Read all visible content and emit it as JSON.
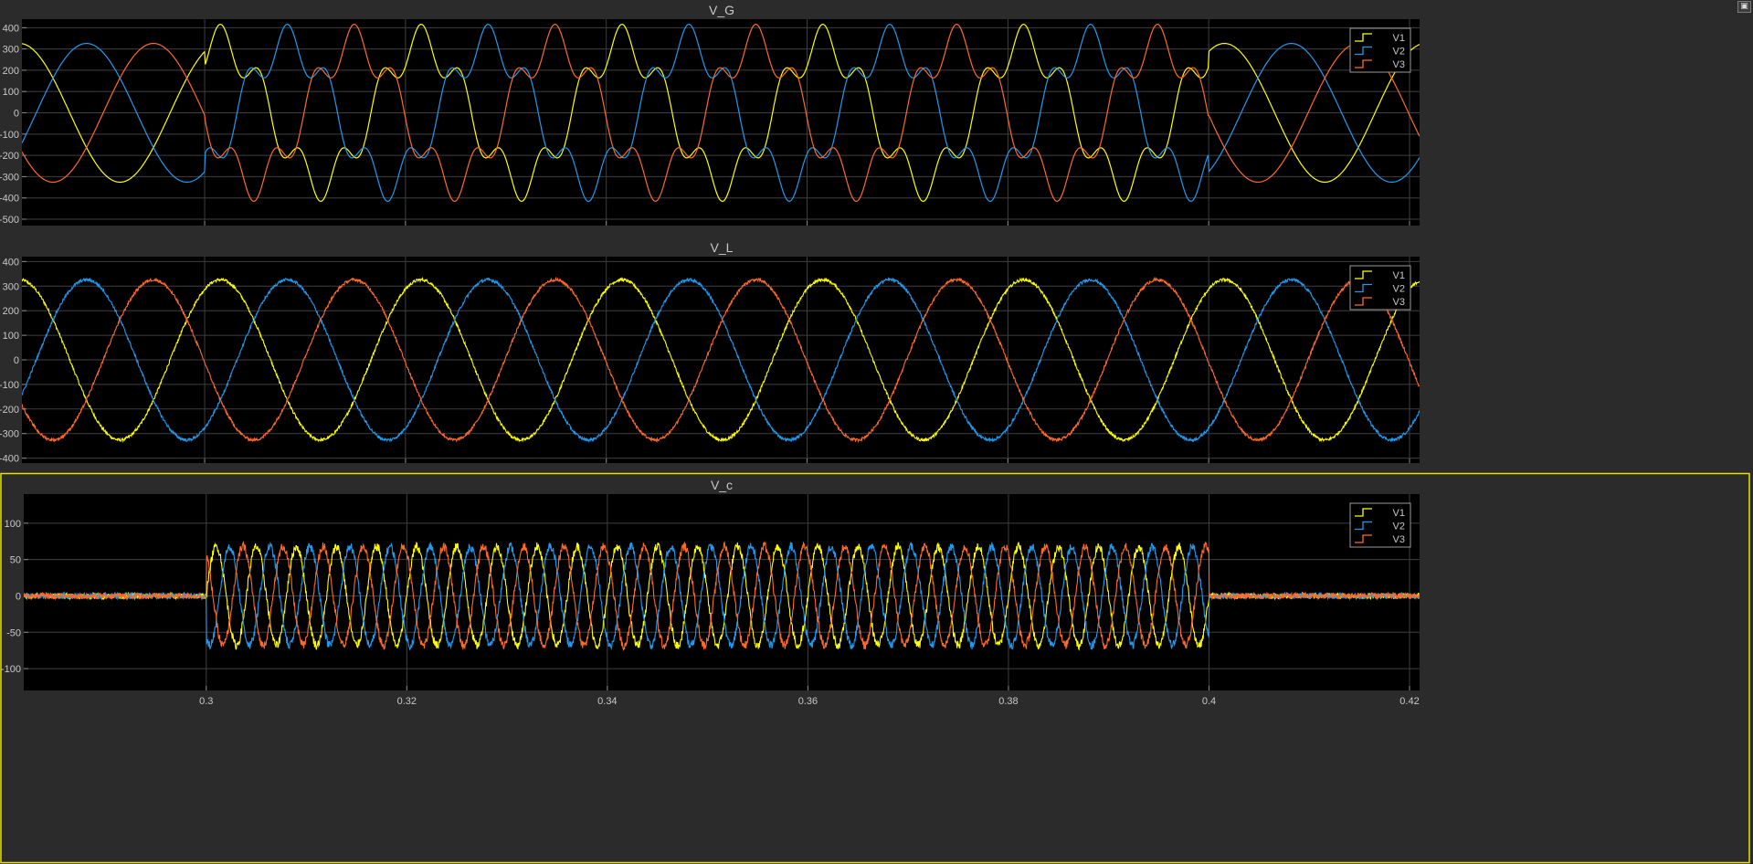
{
  "window": {
    "corner_icon": "restore-icon"
  },
  "colors": {
    "background": "#2b2b2b",
    "plot_bg": "#000000",
    "grid": "#3f3f3f",
    "text": "#c8c8c8",
    "selected_border": "#e8e000",
    "series": [
      "#ffff00",
      "#1e9bf0",
      "#ff6a2a"
    ]
  },
  "chart_data": [
    {
      "type": "line",
      "title": "V_G",
      "xlim": [
        0.2818,
        0.421
      ],
      "ylim": [
        -530,
        440
      ],
      "yticks": [
        400,
        300,
        200,
        100,
        0,
        -100,
        -200,
        -300,
        -400,
        -500
      ],
      "xticks": [
        0.3,
        0.32,
        0.34,
        0.36,
        0.38,
        0.4,
        0.42
      ],
      "show_xtick_labels": false,
      "grid": true,
      "legend": "top-right",
      "waveform": {
        "frequency_hz": 50,
        "amplitude": 326,
        "phase_shift_deg": [
          0,
          -120,
          120
        ],
        "distortion_interval": [
          0.3,
          0.4
        ],
        "distortion_harmonic": 5,
        "distortion_amplitude": 90,
        "noise": 0
      },
      "series": [
        {
          "name": "V1"
        },
        {
          "name": "V2"
        },
        {
          "name": "V3"
        }
      ]
    },
    {
      "type": "line",
      "title": "V_L",
      "xlim": [
        0.2818,
        0.421
      ],
      "ylim": [
        -420,
        420
      ],
      "yticks": [
        400,
        300,
        200,
        100,
        0,
        -100,
        -200,
        -300,
        -400
      ],
      "xticks": [
        0.3,
        0.32,
        0.34,
        0.36,
        0.38,
        0.4,
        0.42
      ],
      "show_xtick_labels": false,
      "grid": true,
      "legend": "top-right",
      "waveform": {
        "frequency_hz": 50,
        "amplitude": 326,
        "phase_shift_deg": [
          0,
          -120,
          120
        ],
        "noise": 6
      },
      "series": [
        {
          "name": "V1"
        },
        {
          "name": "V2"
        },
        {
          "name": "V3"
        }
      ]
    },
    {
      "type": "line",
      "title": "V_c",
      "xlim": [
        0.2818,
        0.421
      ],
      "ylim": [
        -130,
        140
      ],
      "yticks": [
        100,
        50,
        0,
        -50,
        -100
      ],
      "xticks": [
        0.3,
        0.32,
        0.34,
        0.36,
        0.38,
        0.4,
        0.42
      ],
      "xtick_labels": [
        "0.3",
        "0.32",
        "0.34",
        "0.36",
        "0.38",
        "0.4",
        "0.42"
      ],
      "show_xtick_labels": true,
      "grid": true,
      "legend": "top-right",
      "selected": true,
      "waveform": {
        "frequency_hz": 250,
        "amplitude": 68,
        "phase_shift_deg": [
          0,
          -120,
          120
        ],
        "active_interval": [
          0.3,
          0.4
        ],
        "noise": 6,
        "off_noise": 4
      },
      "series": [
        {
          "name": "V1"
        },
        {
          "name": "V2"
        },
        {
          "name": "V3"
        }
      ]
    }
  ]
}
